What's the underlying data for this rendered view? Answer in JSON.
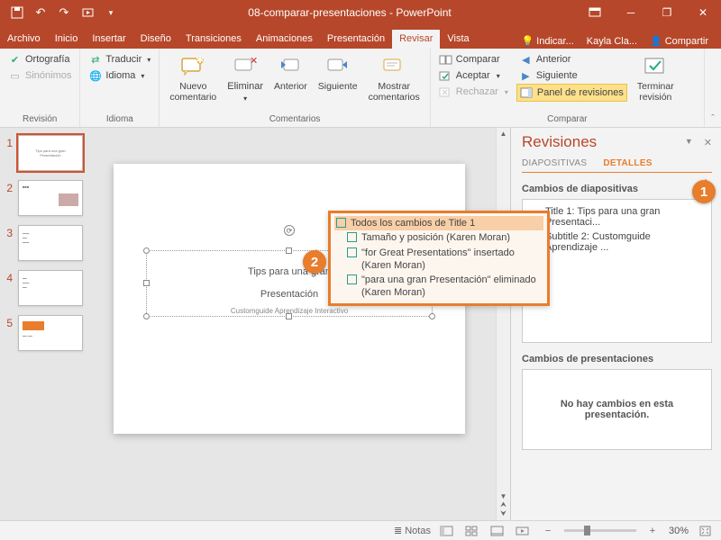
{
  "titlebar": {
    "title": "08-comparar-presentaciones - PowerPoint"
  },
  "menu": {
    "tabs": [
      "Archivo",
      "Inicio",
      "Insertar",
      "Diseño",
      "Transiciones",
      "Animaciones",
      "Presentación",
      "Revisar",
      "Vista"
    ],
    "active_index": 7,
    "tell_me": "Indicar...",
    "user": "Kayla Cla...",
    "share": "Compartir"
  },
  "ribbon": {
    "groups": {
      "revision": {
        "label": "Revisión",
        "spelling": "Ortografía",
        "thesaurus": "Sinónimos"
      },
      "idioma": {
        "label": "Idioma",
        "translate": "Traducir",
        "language": "Idioma"
      },
      "comentarios": {
        "label": "Comentarios",
        "new": "Nuevo\ncomentario",
        "delete": "Eliminar",
        "prev": "Anterior",
        "next": "Siguiente",
        "show": "Mostrar\ncomentarios"
      },
      "comparar": {
        "label": "Comparar",
        "compare": "Comparar",
        "accept": "Aceptar",
        "reject": "Rechazar",
        "prev": "Anterior",
        "next": "Siguiente",
        "panel": "Panel de revisiones",
        "end": "Terminar\nrevisión"
      }
    }
  },
  "thumbs": [
    "1",
    "2",
    "3",
    "4",
    "5"
  ],
  "slide": {
    "title_line1": "Tips para una gran",
    "title_line2": "Presentación",
    "subtitle": "Customguide Aprendizaje Interactivo"
  },
  "change_popup": {
    "header": "Todos los cambios de Title 1",
    "items": [
      "Tamaño y posición (Karen Moran)",
      "\"for Great Presentations\" insertado (Karen Moran)",
      "\"para una gran Presentación\" eliminado (Karen Moran)"
    ]
  },
  "revisions": {
    "title": "Revisiones",
    "tab_slides": "DIAPOSITIVAS",
    "tab_details": "DETALLES",
    "slide_changes_h": "Cambios de diapositivas",
    "slide_changes": [
      "Title 1: Tips para una gran Presentaci...",
      "Subtitle 2: Customguide Aprendizaje ..."
    ],
    "pres_changes_h": "Cambios de presentaciones",
    "pres_empty": "No hay cambios en esta presentación."
  },
  "status": {
    "notes": "Notas",
    "zoom": "30%"
  },
  "callouts": {
    "c1": "1",
    "c2": "2"
  }
}
